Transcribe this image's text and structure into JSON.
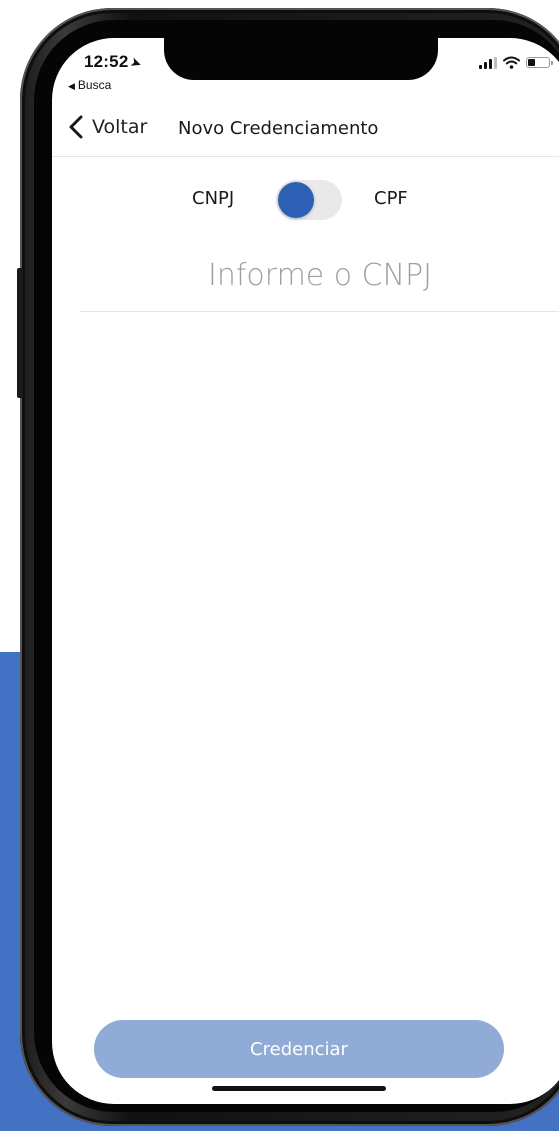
{
  "status_bar": {
    "time": "12:52",
    "back_app": "Busca"
  },
  "nav": {
    "back_label": "Voltar",
    "title": "Novo Credenciamento"
  },
  "toggle": {
    "left_label": "CNPJ",
    "right_label": "CPF",
    "selected": "CNPJ"
  },
  "cnpj_input": {
    "placeholder": "Informe o CNPJ",
    "value": ""
  },
  "submit_button": {
    "label": "Credenciar",
    "enabled": false
  },
  "colors": {
    "accent": "#2d5fb5",
    "button_disabled": "#8fabd6",
    "background_block": "#4372c4"
  }
}
